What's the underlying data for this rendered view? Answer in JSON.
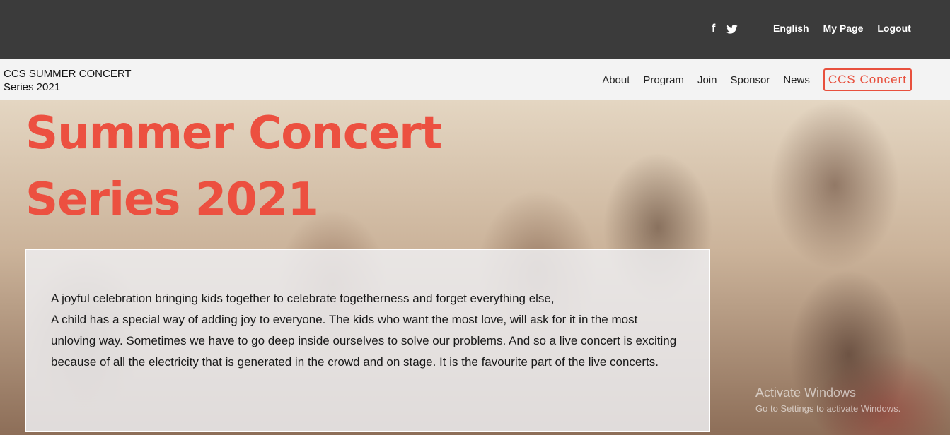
{
  "topbar": {
    "social": {
      "facebook": "f",
      "twitter_icon": "twitter-icon"
    },
    "links": [
      "English",
      "My Page",
      "Logout"
    ]
  },
  "brand": {
    "line1": "CCS SUMMER CONCERT",
    "line2": "Series 2021"
  },
  "nav": {
    "items": [
      "About",
      "Program",
      "Join",
      "Sponsor",
      "News"
    ],
    "cta": "CCS Concert"
  },
  "hero": {
    "title_line1": "Summer Concert",
    "title_line2": "Series 2021",
    "paragraph1": "A joyful celebration bringing kids together to celebrate togetherness and forget everything else,",
    "paragraph2": "A child has a special way of adding joy to everyone. The kids who want the most love, will ask for it in the most unloving way. Sometimes we have to go deep inside ourselves to solve our problems. And so a live concert is exciting because of all the electricity that is generated in the crowd and on stage. It is the favourite part of the live concerts."
  },
  "watermark": {
    "line1": "Activate Windows",
    "line2": "Go to Settings to activate Windows."
  },
  "colors": {
    "accent": "#e8503d",
    "topbar": "#3b3b3b",
    "navbar": "#f3f3f3"
  }
}
